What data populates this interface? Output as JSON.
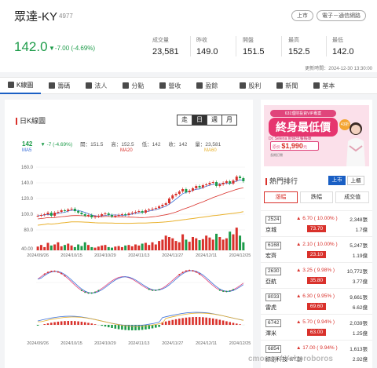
{
  "stock": {
    "name": "眾達-KY",
    "code": "4977",
    "market_tag": "上市",
    "industry_tag": "電子－通信網路",
    "price": "142.0",
    "change": "▼-7.00 (-4.69%)"
  },
  "stats": [
    {
      "label": "成交量",
      "value": "23,581"
    },
    {
      "label": "昨收",
      "value": "149.0"
    },
    {
      "label": "開盤",
      "value": "151.5"
    },
    {
      "label": "最高",
      "value": "152.5"
    },
    {
      "label": "最低",
      "value": "142.0"
    }
  ],
  "update_time": "更新時間：2024-12-30 13:30:00",
  "nav_tabs": [
    {
      "label": "K線圖",
      "icon": "kline-icon",
      "active": true
    },
    {
      "label": "籌碼",
      "icon": "chips-icon"
    },
    {
      "label": "法人",
      "icon": "institution-icon"
    },
    {
      "label": "分點",
      "icon": "broker-icon"
    },
    {
      "label": "營收",
      "icon": "revenue-icon"
    },
    {
      "label": "盈餘",
      "icon": "dollar-icon"
    },
    {
      "label": "股利",
      "icon": "dividend-icon"
    },
    {
      "label": "新聞",
      "icon": "news-icon"
    },
    {
      "label": "基本",
      "icon": "grid-icon"
    }
  ],
  "chart_panel": {
    "title": "日K線圖",
    "periods": [
      "走",
      "日",
      "週",
      "月"
    ],
    "active_period": "日",
    "ohlc": {
      "last": "142",
      "change": "▼ -7 (-4.69%)",
      "open": "開：151.5",
      "high": "高：152.5",
      "low": "低：142",
      "close": "收：142",
      "volume": "量：23,581"
    },
    "ma_labels": [
      {
        "label": "MA5",
        "color": "#3a6fd8"
      },
      {
        "label": "MA20",
        "color": "#d9312b"
      },
      {
        "label": "MA60",
        "color": "#e9b12c"
      }
    ]
  },
  "chart_data": {
    "type": "candlestick",
    "x_ticks": [
      "2024/09/26",
      "2024/10/15",
      "2024/10/29",
      "2024/11/13",
      "2024/11/27",
      "2024/12/11",
      "2024/12/25"
    ],
    "price_ticks": [
      160.0,
      140.0,
      120.0,
      100.0,
      80.0
    ],
    "price_range": [
      70,
      162
    ],
    "volume_ticks": [
      40.0
    ],
    "closes": [
      98,
      99,
      100,
      102,
      98,
      102,
      103,
      105,
      104,
      106,
      107,
      104,
      102,
      100,
      98,
      99,
      96,
      97,
      98,
      100,
      101,
      99,
      97,
      98,
      99,
      100,
      99,
      101,
      102,
      103,
      104,
      102,
      105,
      106,
      107,
      108,
      110,
      112,
      114,
      120,
      124,
      126,
      129,
      132,
      128,
      130,
      133,
      136,
      134,
      137,
      138,
      140,
      141,
      136,
      138,
      140,
      142,
      139,
      143,
      148,
      146,
      142
    ],
    "volumes": [
      0.14,
      0.2,
      0.12,
      0.28,
      0.18,
      0.22,
      0.3,
      0.15,
      0.2,
      0.25,
      0.18,
      0.12,
      0.22,
      0.16,
      0.3,
      0.2,
      0.12,
      0.1,
      0.14,
      0.18,
      0.2,
      0.12,
      0.1,
      0.14,
      0.16,
      0.12,
      0.18,
      0.2,
      0.15,
      0.22,
      0.18,
      0.25,
      0.28,
      0.2,
      0.3,
      0.22,
      0.35,
      0.4,
      0.55,
      0.5,
      0.45,
      0.35,
      0.3,
      0.6,
      0.4,
      0.32,
      0.5,
      0.45,
      0.38,
      0.42,
      0.55,
      0.48,
      0.4,
      0.62,
      0.5,
      0.4,
      0.45,
      0.7,
      0.6,
      0.85,
      0.55,
      0.3
    ]
  },
  "sidebar": {
    "ad": {
      "top_line": "631理財投資VIP專案",
      "headline": "終身最低價",
      "badge": "43折",
      "name_line": "Dr. Selena 財經早餐帳單",
      "price_prefix": "原价",
      "price": "$1,990",
      "price_suffix": "元",
      "fine_print": "長期訂閱"
    },
    "hot_title": "熱門排行",
    "markets": [
      "上市",
      "上櫃"
    ],
    "sub_tabs": [
      "漲幅",
      "跌幅",
      "成交值"
    ],
    "rows": [
      {
        "code": "2524",
        "name": "京城",
        "change": "▲ 6.70 ( 10.00% )",
        "price": "73.70",
        "volume": "2,348張",
        "amount": "1.7億"
      },
      {
        "code": "6168",
        "name": "宏齊",
        "change": "▲ 2.10 ( 10.00% )",
        "price": "23.10",
        "volume": "5,247張",
        "amount": "1.19億"
      },
      {
        "code": "2630",
        "name": "亞航",
        "change": "▲ 3.25 ( 9.98% )",
        "price": "35.80",
        "volume": "10,772張",
        "amount": "3.77億"
      },
      {
        "code": "8033",
        "name": "雷虎",
        "change": "▲ 6.30 ( 9.95% )",
        "price": "69.60",
        "volume": "9,661張",
        "amount": "6.62億"
      },
      {
        "code": "6742",
        "name": "澤米",
        "change": "▲ 5.70 ( 9.94% )",
        "price": "63.00",
        "volume": "2,039張",
        "amount": "1.25億"
      },
      {
        "code": "6854",
        "name": "錼創科技-KY創",
        "change": "▲ 17.00 ( 9.94% )",
        "price": "",
        "volume": "1,613張",
        "amount": "2.92億"
      }
    ]
  },
  "watermark": "cmoney / Yoboroboros"
}
